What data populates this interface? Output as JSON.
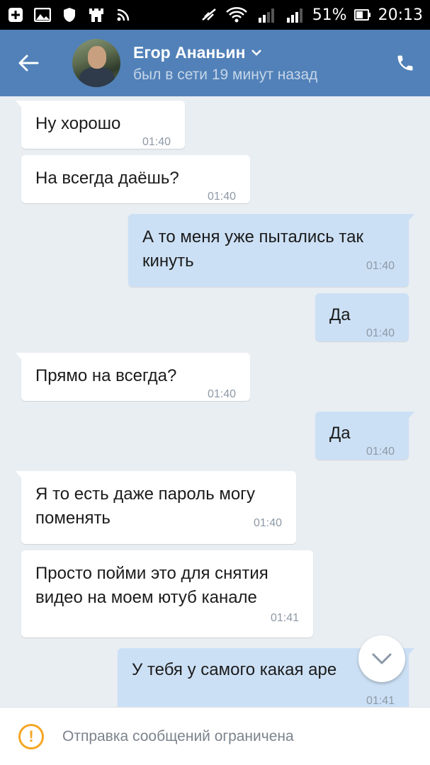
{
  "status_bar": {
    "battery": "51%",
    "time": "20:13"
  },
  "header": {
    "name": "Егор Ананьин",
    "last_seen": "был в сети 19 минут назад"
  },
  "messages": [
    {
      "dir": "in",
      "text": "Ну хорошо",
      "time": "01:40"
    },
    {
      "dir": "in",
      "text": "На всегда даёшь?",
      "time": "01:40"
    },
    {
      "dir": "out",
      "text": "А то меня уже пытались так кинуть",
      "time": "01:40"
    },
    {
      "dir": "out",
      "text": "Да",
      "time": "01:40"
    },
    {
      "dir": "in",
      "text": "Прямо на всегда?",
      "time": "01:40"
    },
    {
      "dir": "out",
      "text": "Да",
      "time": "01:40"
    },
    {
      "dir": "in",
      "text": "Я то есть даже пароль могу поменять",
      "time": "01:40"
    },
    {
      "dir": "in",
      "text": "Просто пойми это для снятия видео на моем ютуб канале",
      "time": "01:41"
    },
    {
      "dir": "out",
      "text": "У тебя у самого какая аре",
      "time": "01:41"
    }
  ],
  "footer": {
    "notice": "Отправка сообщений ограничена"
  },
  "colors": {
    "header": "#5181b8",
    "incoming": "#ffffff",
    "outgoing": "#cce0f5",
    "background": "#e9eef3",
    "warning": "#f5a623"
  }
}
